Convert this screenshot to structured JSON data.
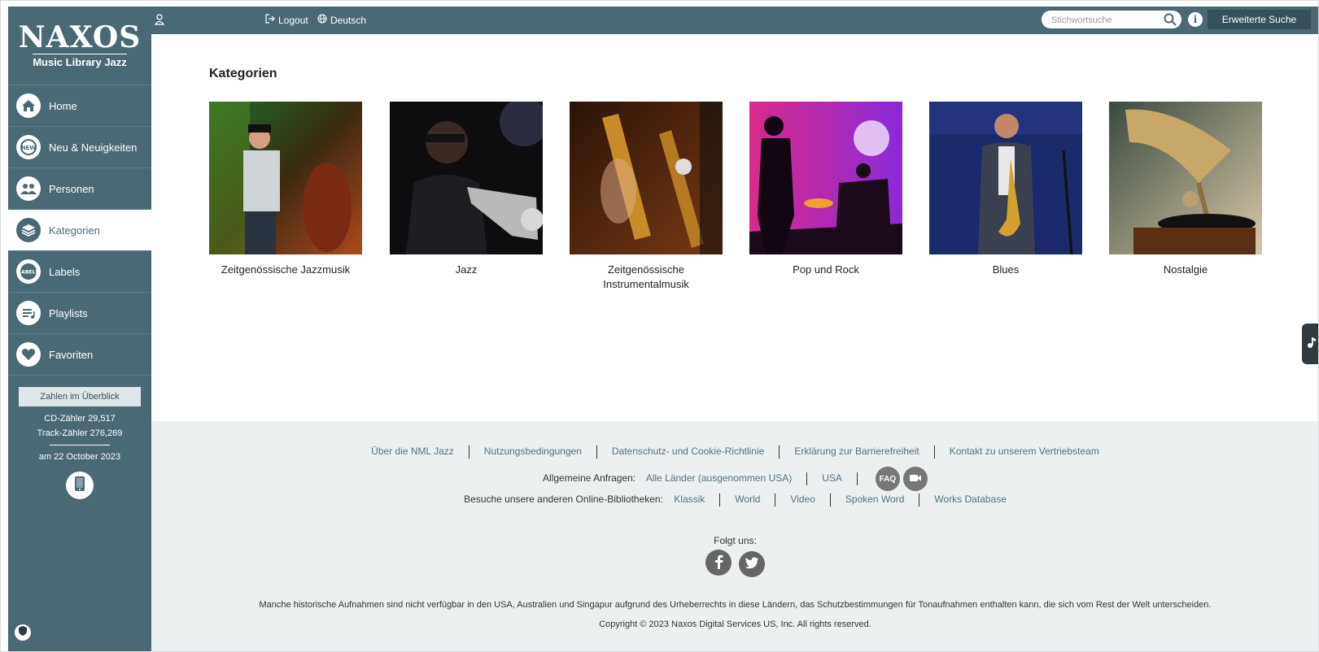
{
  "logo": {
    "main": "NAXOS",
    "sub": "Music Library Jazz"
  },
  "topbar": {
    "logout": "Logout",
    "language": "Deutsch",
    "search_placeholder": "Stichwortsuche",
    "advanced_search": "Erweiterte Suche",
    "info": "i"
  },
  "nav": [
    {
      "label": "Home",
      "icon": "home-icon"
    },
    {
      "label": "Neu & Neuigkeiten",
      "icon": "new-icon"
    },
    {
      "label": "Personen",
      "icon": "people-icon"
    },
    {
      "label": "Kategorien",
      "icon": "layers-icon",
      "active": true
    },
    {
      "label": "Labels",
      "icon": "labels-icon"
    },
    {
      "label": "Playlists",
      "icon": "playlist-icon"
    },
    {
      "label": "Favoriten",
      "icon": "heart-icon"
    }
  ],
  "stats": {
    "button": "Zahlen im Überblick",
    "cd_count": "CD-Zähler 29,517",
    "track_count": "Track-Zähler 276,269",
    "date": "am 22 October 2023"
  },
  "main": {
    "title": "Kategorien",
    "categories": [
      {
        "label": "Zeitgenössische Jazzmusik"
      },
      {
        "label": "Jazz"
      },
      {
        "label": "Zeitgenössische Instrumentalmusik"
      },
      {
        "label": "Pop und Rock"
      },
      {
        "label": "Blues"
      },
      {
        "label": "Nostalgie"
      }
    ]
  },
  "footer": {
    "links": [
      "Über die NML Jazz",
      "Nutzungsbedingungen",
      "Datenschutz- und Cookie-Richtlinie",
      "Erklärung zur Barrierefreiheit",
      "Kontakt zu unserem Vertriebsteam"
    ],
    "inquiries_label": "Allgemeine Anfragen:",
    "inquiries": [
      "Alle Länder (ausgenommen USA)",
      "USA"
    ],
    "faq": "FAQ",
    "libraries_label": "Besuche unsere anderen Online-Bibliotheken:",
    "libraries": [
      "Klassik",
      "World",
      "Video",
      "Spoken Word",
      "Works Database"
    ],
    "follow": "Folgt uns:",
    "disclaimer": "Manche historische Aufnahmen sind nicht verfügbar in den USA, Australien und Singapur aufgrund des Urheberrechts in diese Ländern, das Schutzbestimmungen für Tonaufnahmen enthalten kann, die sich vom Rest der Welt unterscheiden.",
    "copyright": "Copyright © 2023 Naxos Digital Services US, Inc. All rights reserved."
  },
  "colors": {
    "brand": "#4b6974",
    "link": "#4e7180",
    "footer_bg": "#edf0f1"
  }
}
